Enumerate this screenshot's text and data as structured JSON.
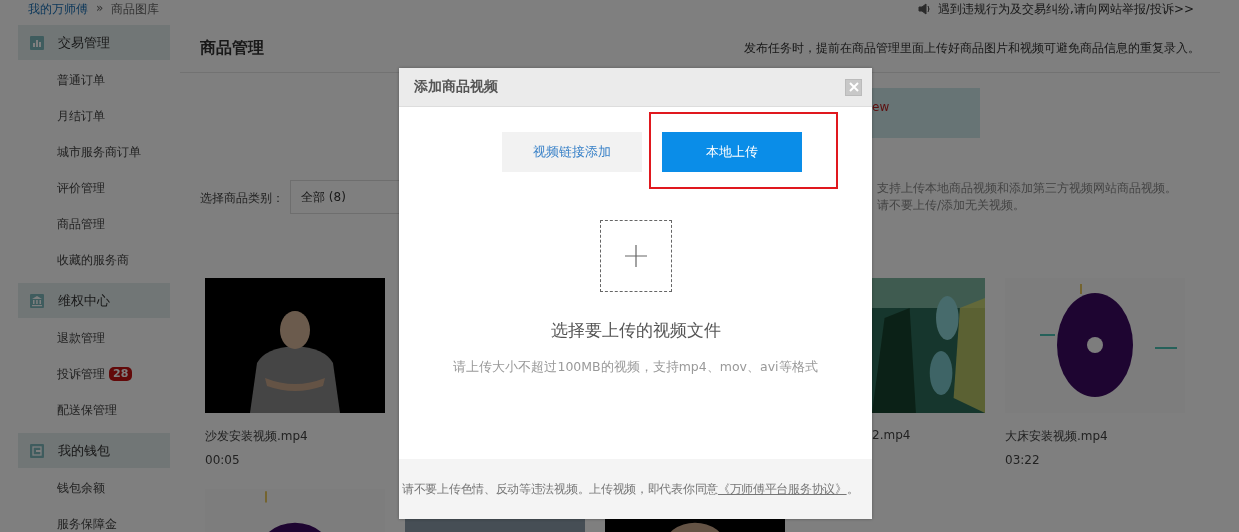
{
  "breadcrumb": {
    "items": [
      "我的万师傅",
      "商品图库"
    ],
    "separator": "»"
  },
  "report_notice": "遇到违规行为及交易纠纷,请向网站举报/投诉>>",
  "sidebar": {
    "sections": [
      {
        "title": "交易管理",
        "items": [
          {
            "label": "普通订单"
          },
          {
            "label": "月结订单"
          },
          {
            "label": "城市服务商订单"
          },
          {
            "label": "评价管理"
          },
          {
            "label": "商品管理"
          },
          {
            "label": "收藏的服务商"
          }
        ]
      },
      {
        "title": "维权中心",
        "items": [
          {
            "label": "退款管理"
          },
          {
            "label": "投诉管理",
            "badge": "28"
          },
          {
            "label": "配送保管理"
          }
        ]
      },
      {
        "title": "我的钱包",
        "items": [
          {
            "label": "钱包余额"
          },
          {
            "label": "服务保障金"
          }
        ]
      }
    ]
  },
  "main": {
    "title": "商品管理",
    "tip": "发布任务时，提前在商品管理里面上传好商品图片和视频可避免商品信息的重复录入。",
    "notice": "ew",
    "category": {
      "label": "选择商品类别：",
      "value": "全部 (8)"
    },
    "category_tip": [
      "支持上传本地商品视频和添加第三方视频网站商品视频。",
      "请不要上传/添加无关视频。"
    ],
    "videos": [
      {
        "kind": "full",
        "name": "沙发安装视频.mp4",
        "duration": "00:05"
      },
      {
        "kind": "cut",
        "name": "2.mp4"
      },
      {
        "kind": "full",
        "name": "大床安装视频.mp4",
        "duration": "03:22"
      }
    ]
  },
  "dialog": {
    "title": "添加商品视频",
    "tabs": [
      {
        "label": "视频链接添加",
        "selected": false
      },
      {
        "label": "本地上传",
        "selected": true
      }
    ],
    "upload_title": "选择要上传的视频文件",
    "upload_hint": "请上传大小不超过100MB的视频，支持mp4、mov、avi等格式",
    "footer": {
      "text": "请不要上传色情、反动等违法视频。上传视频，即代表你同意",
      "link": "《万师傅平台服务协议》",
      "end": "。"
    }
  }
}
